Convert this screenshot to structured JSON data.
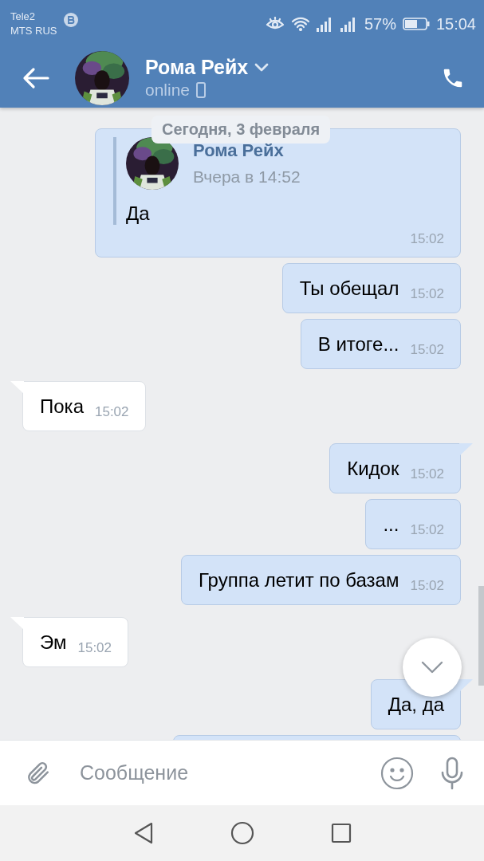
{
  "status_bar": {
    "carrier_1": "Tele2",
    "carrier_2": "MTS RUS",
    "battery": "57%",
    "time": "15:04"
  },
  "header": {
    "name": "Рома Рейх",
    "status": "online"
  },
  "date_pill": "Сегодня, 3 февраля",
  "messages": [
    {
      "kind": "forward",
      "forward": {
        "name": "Рома Рейх",
        "date": "Вчера в 14:52",
        "text": "Да"
      },
      "time": "15:02"
    },
    {
      "kind": "text",
      "outgoing": true,
      "tail": false,
      "text": "Ты обещал",
      "time": "15:02"
    },
    {
      "kind": "text",
      "outgoing": true,
      "tail": false,
      "text": "В итоге...",
      "time": "15:02"
    },
    {
      "kind": "text",
      "outgoing": false,
      "tail": true,
      "text": "Пока",
      "time": "15:02"
    },
    {
      "kind": "text",
      "outgoing": true,
      "tail": true,
      "text": "Кидок",
      "time": "15:02"
    },
    {
      "kind": "text",
      "outgoing": true,
      "tail": false,
      "text": "...",
      "time": "15:02"
    },
    {
      "kind": "text",
      "outgoing": true,
      "tail": false,
      "text": "Группа летит по базам",
      "time": "15:02"
    },
    {
      "kind": "text",
      "outgoing": false,
      "tail": true,
      "text": "Эм",
      "time": "15:02"
    },
    {
      "kind": "text",
      "outgoing": true,
      "tail": true,
      "text": "Да, да"
    },
    {
      "kind": "cut",
      "outgoing": true
    }
  ],
  "composer": {
    "placeholder": "Сообщение"
  }
}
